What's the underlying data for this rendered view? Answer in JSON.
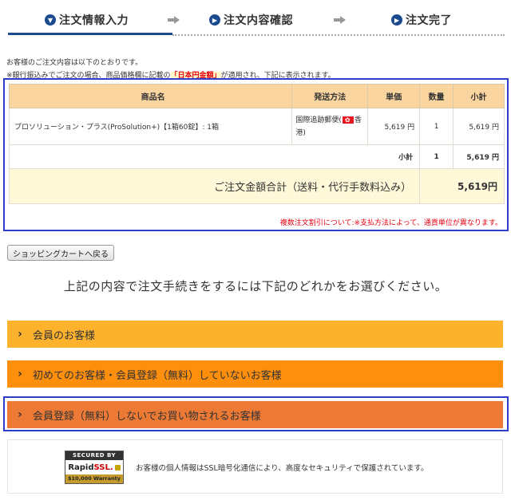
{
  "steps": [
    {
      "icon": "▼",
      "label": "注文情報入力"
    },
    {
      "icon": "▶",
      "label": "注文内容確認"
    },
    {
      "icon": "▶",
      "label": "注文完了"
    }
  ],
  "notice": {
    "line1": "お客様のご注文内容は以下のとおりです。",
    "line2_pre": "※銀行振込みでご注文の場合、商品価格欄に記載の",
    "line2_highlight": "「日本円金額」",
    "line2_post": "が適用され、下記に表示されます。"
  },
  "order_table": {
    "headers": {
      "name": "商品名",
      "shipping": "発送方法",
      "price": "単価",
      "qty": "数量",
      "subtotal": "小計"
    },
    "item": {
      "name": "プロソリューション・プラス(ProSolution+)【1箱60錠】: 1箱",
      "shipping_pre": "国際追跡郵便(",
      "shipping_post": "香港)",
      "price": "5,619 円",
      "qty": "1",
      "subtotal": "5,619 円"
    },
    "subtotal_row": {
      "label": "小計",
      "qty": "1",
      "value": "5,619 円"
    },
    "total_row": {
      "label": "ご注文金額合計（送料・代行手数料込み）",
      "value": "5,619円"
    },
    "split_note": "複数注文割引について:※支払方法によって、通貨単位が異なります。"
  },
  "back_button": "ショッピングカートへ戻る",
  "choose_text": "上記の内容で注文手続きをするには下記のどれかをお選びください。",
  "options": {
    "member": "会員のお客様",
    "first": "初めてのお客様・会員登録（無料）していないお客様",
    "guest": "会員登録（無料）しないでお買い物されるお客様"
  },
  "ssl": {
    "badge_top": "SECURED BY",
    "badge_rapid": "Rapid",
    "badge_ssl": "SSL.",
    "badge_bottom": "$10,000 Warranty",
    "text": "お客様の個人情報はSSL暗号化通信により、高度なセキュリティで保護されています。"
  },
  "colors": {
    "accent_blue": "#1b4a8e",
    "highlight_border": "#2e3ec8",
    "option_member": "#fdb22e",
    "option_first": "#fd8f0d",
    "option_guest": "#ec7a35",
    "alert_red": "#e60012"
  }
}
